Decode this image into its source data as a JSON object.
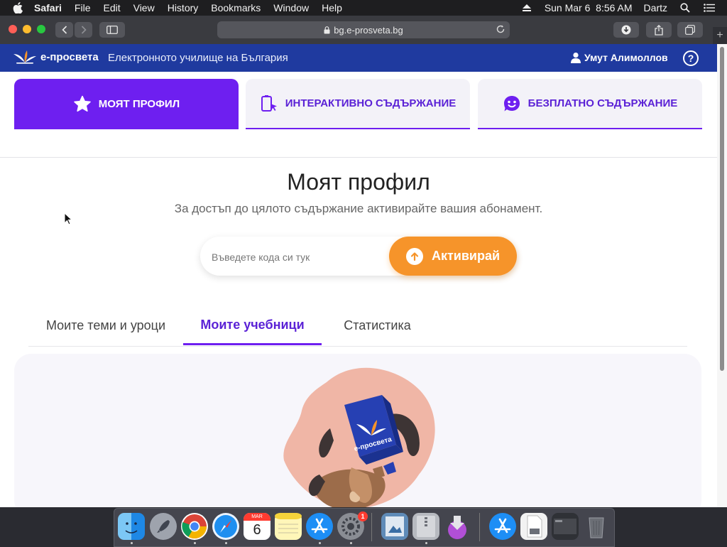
{
  "menubar": {
    "app": "Safari",
    "items": [
      "File",
      "Edit",
      "View",
      "History",
      "Bookmarks",
      "Window",
      "Help"
    ],
    "clock": "Sun Mar 6  8:56 AM",
    "user": "Dartz"
  },
  "browser": {
    "url": "bg.e-prosveta.bg"
  },
  "site": {
    "logo_text": "е-просвета",
    "tagline": "Електронното училище на България",
    "user_name": "Умут Алимоллов",
    "help_label": "?"
  },
  "tabs": [
    {
      "label": "Моят профил",
      "icon": "star-icon"
    },
    {
      "label": "Интерактивно съдържание",
      "icon": "interactive-cursor-icon"
    },
    {
      "label": "Безплатно съдържание",
      "icon": "smiley-chat-icon"
    }
  ],
  "profile": {
    "title": "Моят профил",
    "subtitle": "За достъп до цялото съдържание активирайте вашия абонамент.",
    "code_placeholder": "Въведете кода си тук",
    "activate_label": "Активирай"
  },
  "subtabs": [
    {
      "label": "Моите теми и уроци",
      "active": false
    },
    {
      "label": "Моите учебници",
      "active": true
    },
    {
      "label": "Статистика",
      "active": false
    }
  ],
  "illustration": {
    "book_text": "е-просвета"
  },
  "dock": {
    "calendar_month": "MAR",
    "calendar_day": "6",
    "prefs_badge": "1"
  },
  "colors": {
    "header_blue": "#1f3a9f",
    "accent_purple": "#6e1ff0",
    "activate_orange": "#f6942a"
  }
}
